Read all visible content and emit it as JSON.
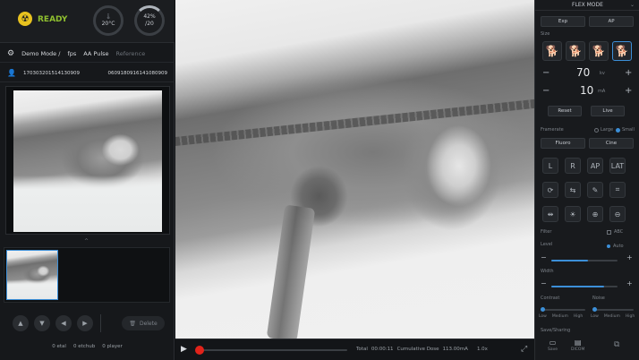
{
  "status": {
    "label": "READY",
    "temp": "20°C",
    "capacity_line1": "42%",
    "capacity_line2": "/20"
  },
  "mode": {
    "demo": "Demo Mode /",
    "fps": "fps",
    "pulse": "AA Pulse",
    "reference": "Reference"
  },
  "patient": {
    "id": "170303201514130909",
    "series": "0609180916141080909"
  },
  "thumb_caret": "^",
  "nav": {
    "delete": "Delete"
  },
  "counts": {
    "a": "0",
    "a_label": "etal",
    "b": "0",
    "b_label": "etchub",
    "c": "0",
    "c_label": "player"
  },
  "player": {
    "total_label": "Total",
    "total": "00:00:11",
    "dose_label": "Cumulative Dose",
    "dose": "113.00mA",
    "speed": "1.0x"
  },
  "right": {
    "title": "FLEX MODE",
    "tabs": [
      "Exp",
      "AP"
    ],
    "size_label": "Size",
    "kv_value": "70",
    "kv_unit": "kv",
    "ma_value": "10",
    "ma_unit": "mA",
    "btn_reset": "Reset",
    "btn_live": "Live",
    "framerate_label": "Framerate",
    "opt_large": "Large",
    "opt_small": "Small",
    "mode_tabs": [
      "Fluoro",
      "Cine"
    ],
    "views": [
      "L",
      "R",
      "AP",
      "LAT"
    ],
    "filter_label": "Filter",
    "filter_opt": "ABC",
    "level_label": "Level",
    "level_opt": "Auto",
    "width_label": "Width",
    "contrast_label": "Contrast",
    "noise_label": "Noise",
    "contrast_opts": [
      "Low",
      "Medium",
      "High"
    ],
    "noise_opts": [
      "Low",
      "Medium",
      "High"
    ],
    "save_label": "Save/Sharing",
    "save_a": "Save",
    "save_b": "DICOM"
  },
  "colors": {
    "accent": "#3c8fd8",
    "ready": "#8fbf2f",
    "record": "#e2231a"
  }
}
